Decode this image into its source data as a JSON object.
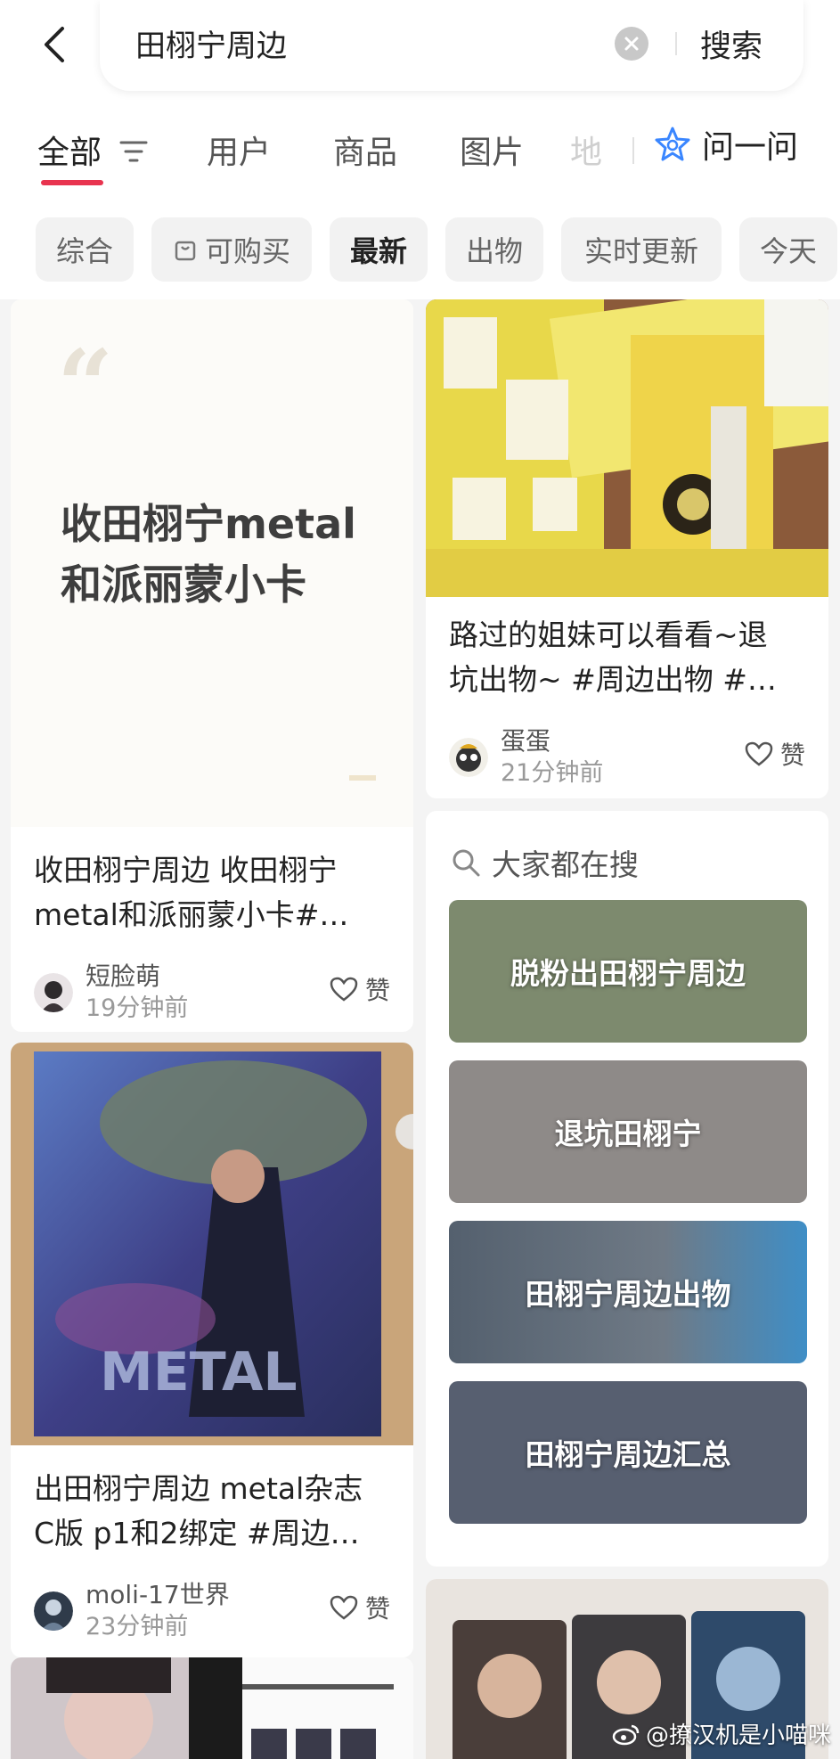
{
  "search": {
    "query": "田栩宁周边",
    "button_label": "搜索"
  },
  "tabs": [
    {
      "label": "全部"
    },
    {
      "label": "用户"
    },
    {
      "label": "商品"
    },
    {
      "label": "图片"
    },
    {
      "label": "地"
    }
  ],
  "ask_label": "问一问",
  "chips": [
    {
      "label": "综合"
    },
    {
      "label": "可购买"
    },
    {
      "label": "最新"
    },
    {
      "label": "出物"
    },
    {
      "label": "实时更新"
    },
    {
      "label": "今天"
    }
  ],
  "posts": [
    {
      "cover_text": "收田栩宁metal和派丽蒙小卡",
      "title_line1": "收田栩宁周边 收田栩宁",
      "title_line2": "metal和派丽蒙小卡#…",
      "author": "短脸萌",
      "time": "19分钟前",
      "like_label": "赞"
    },
    {
      "title_line1": "路过的姐妹可以看看~退",
      "title_line2": "坑出物~ #周边出物 #…",
      "author": "蛋蛋",
      "time": "21分钟前",
      "like_label": "赞"
    },
    {
      "cover_text": "METAL",
      "title_line1": "出田栩宁周边 metal杂志",
      "title_line2": "C版 p1和2绑定 #周边…",
      "author": "moli-17世界",
      "time": "23分钟前",
      "like_label": "赞"
    }
  ],
  "suggestions": {
    "heading": "大家都在搜",
    "items": [
      {
        "label": "脱粉出田栩宁周边"
      },
      {
        "label": "退坑田栩宁"
      },
      {
        "label": "田栩宁周边出物"
      },
      {
        "label": "田栩宁周边汇总"
      }
    ]
  },
  "watermark": "@撩汉机是小喵咪",
  "colors": {
    "accent": "#e8344f",
    "ask_icon": "#3a86ff"
  }
}
